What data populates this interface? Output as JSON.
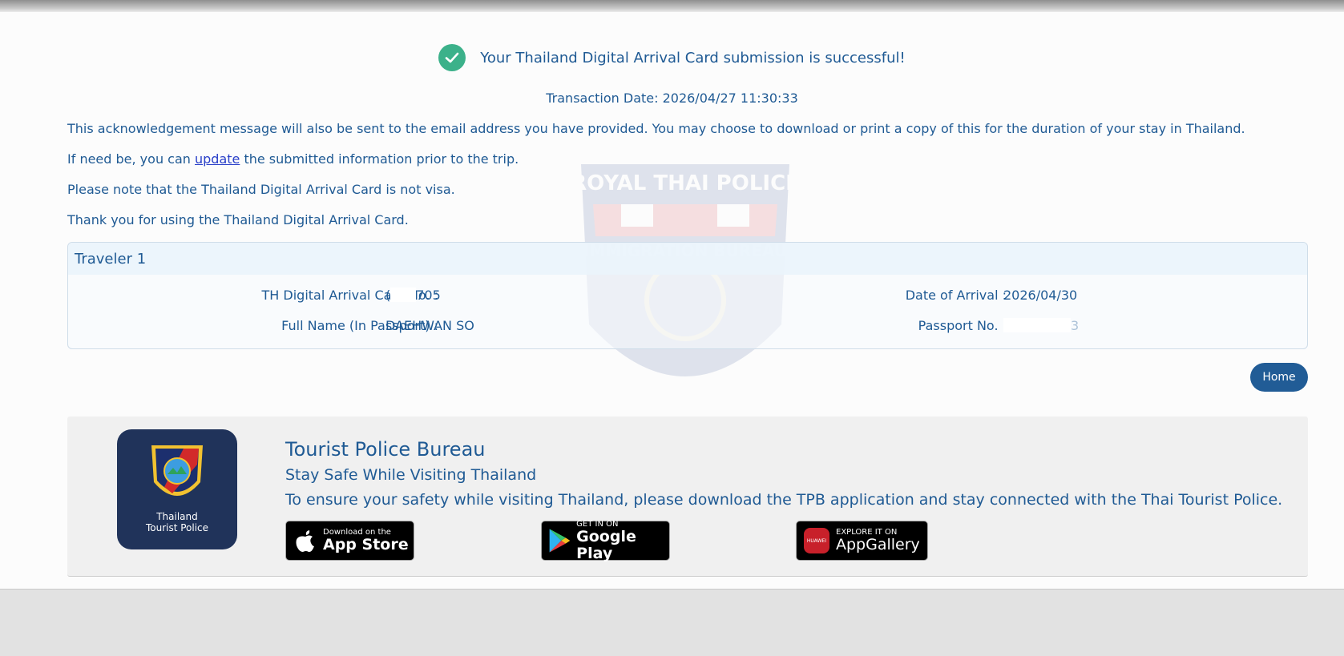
{
  "success": {
    "message": "Your Thailand Digital Arrival Card submission is successful!",
    "transaction_date": "Transaction Date: 2026/04/27 11:30:33"
  },
  "messages": {
    "line1": "This acknowledgement message will also be sent to the email address you have provided. You may choose to download or print a copy of this for the duration of your stay in Thailand.",
    "line2_prefix": "If need be, you can ",
    "line2_link": "update",
    "line2_suffix": " the submitted information prior to the trip.",
    "line3": "Please note that the Thailand Digital Arrival Card is not visa.",
    "line4": "Thank you for using the Thailand Digital Arrival Card."
  },
  "watermark": {
    "top_text": "ROYAL THAI POLICE",
    "band_text": "IMMIGRATION BUREAU"
  },
  "traveler": {
    "header": "Traveler 1",
    "card_no_label": "TH Digital Arrival Card No. :",
    "card_no_prefix": "(",
    "card_no_suffix": "705",
    "arrival_label": "Date of Arrival :",
    "arrival_value": "2026/04/30",
    "name_label": "Full Name (In Passport) :",
    "name_value": "DAEHWAN SO",
    "passport_label": "Passport No. :",
    "passport_suffix": "3"
  },
  "home_button": "Home",
  "tpb": {
    "logo_line1": "Thailand",
    "logo_line2": "Tourist Police",
    "title": "Tourist Police Bureau",
    "subtitle": "Stay Safe While Visiting Thailand",
    "description": "To ensure your safety while visiting Thailand, please download the TPB application and stay connected with the Thai Tourist Police.",
    "app_store_small": "Download on the",
    "app_store_big": "App Store",
    "google_play_small": "GET IN ON",
    "google_play_big": "Google Play",
    "app_gallery_small": "EXPLORE IT ON",
    "app_gallery_big": "AppGallery",
    "huawei_label": "HUAWEI"
  },
  "colors": {
    "primary_text": "#1f5a94",
    "success_green": "#3cb18a",
    "home_button": "#215c96",
    "tpb_logo_bg": "#20335a",
    "link": "#2a40c9"
  }
}
